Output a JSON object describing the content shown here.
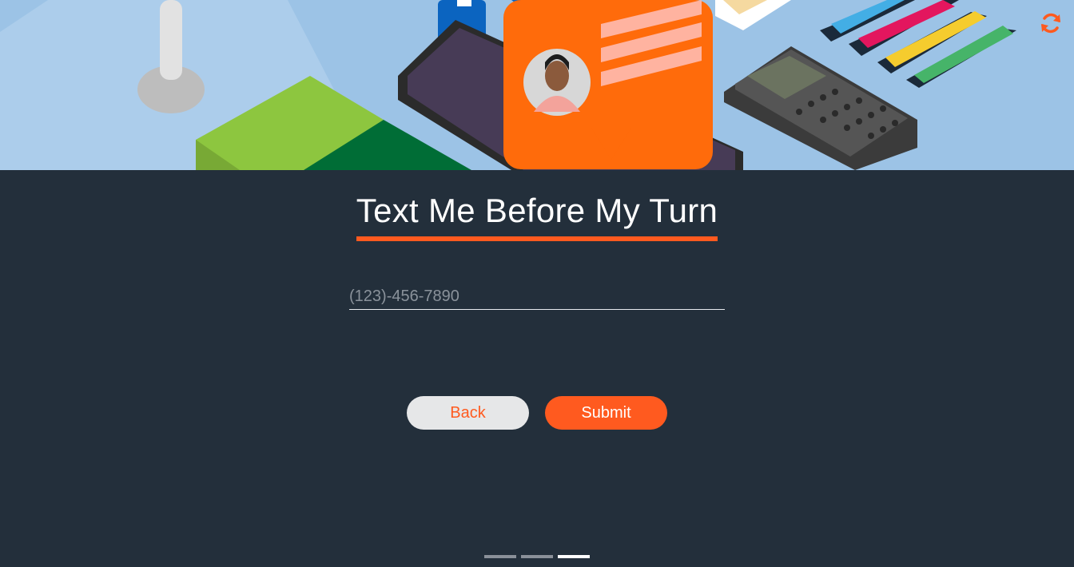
{
  "hero": {
    "illustration": "desk-illustration-phone-chat-calculator-markers"
  },
  "toolbar": {
    "refresh_icon": "refresh-icon"
  },
  "form": {
    "title": "Text Me Before My Turn",
    "phone_placeholder": "(123)-456-7890",
    "phone_value": ""
  },
  "buttons": {
    "back_label": "Back",
    "submit_label": "Submit"
  },
  "pager": {
    "total": 3,
    "active_index": 2
  },
  "colors": {
    "accent": "#ff5a1f",
    "background": "#232f3b",
    "hero_sky": "#9cc3e6",
    "back_button_bg": "#e6e7e8"
  }
}
